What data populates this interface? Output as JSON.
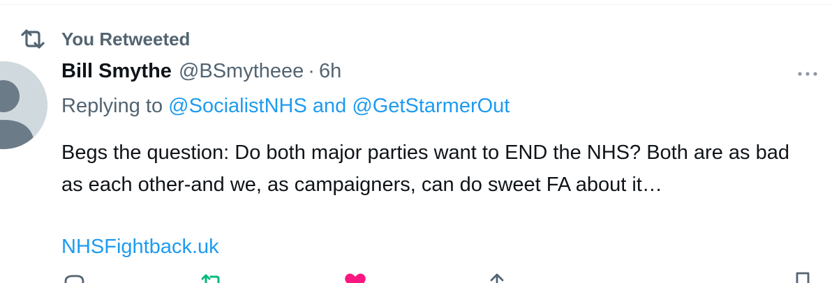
{
  "retweet_header": {
    "label": "You Retweeted",
    "icon": "retweet-icon"
  },
  "author": {
    "name": "Bill Smythe",
    "handle": "@BSmytheee",
    "separator": "·",
    "time": "6h"
  },
  "reply": {
    "prefix": "Replying to ",
    "mention1": "@SocialistNHS",
    "conjunction": " and ",
    "mention2": "@GetStarmerOut"
  },
  "tweet": {
    "text": "Begs the question: Do both major parties want to END the NHS? Both are as bad as each other-and we, as campaigners, can do sweet FA about it…",
    "link": "NHSFightback.uk"
  },
  "actions": {
    "icons": [
      "reply-icon",
      "retweet-icon",
      "like-icon",
      "share-icon",
      "bookmark-icon"
    ]
  },
  "colors": {
    "text": "#0f1419",
    "secondary": "#536471",
    "link": "#1d9bf0",
    "retweet": "#00ba7c",
    "like": "#f91880",
    "avatar_bg": "#cfd9de",
    "avatar_fg": "#6b7b87"
  }
}
